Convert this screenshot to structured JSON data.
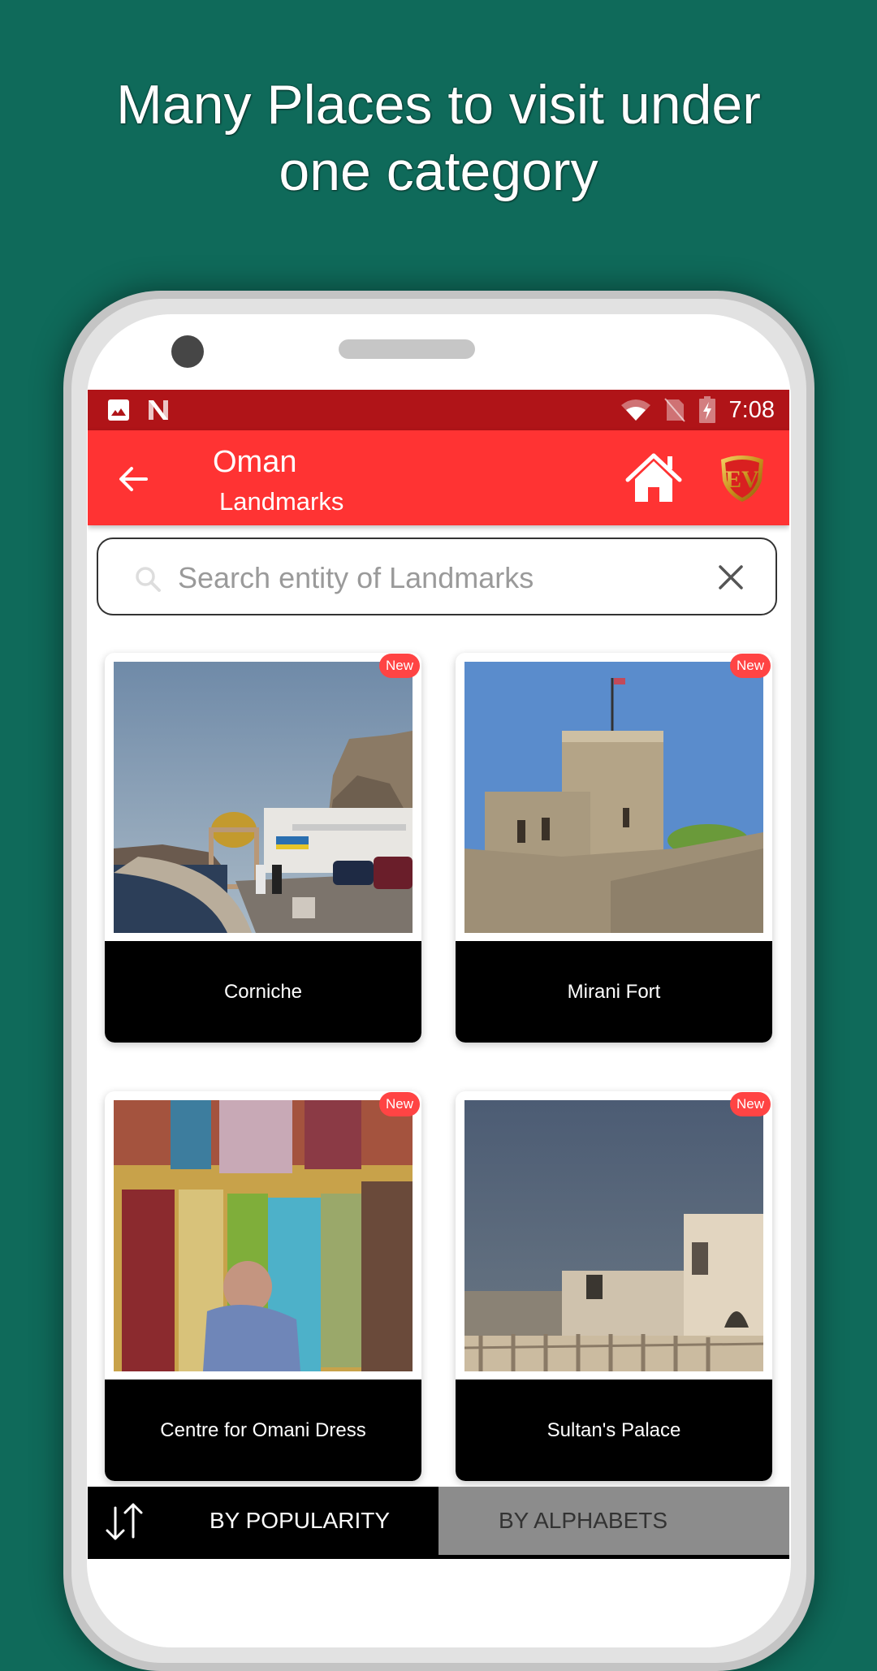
{
  "promo": {
    "headline_line1": "Many Places to visit under",
    "headline_line2": "one category"
  },
  "colors": {
    "background": "#0f6a5a",
    "status_bar": "#b01418",
    "app_bar": "#ff3333",
    "badge": "#ff4444",
    "tab_inactive": "#8c8c8c"
  },
  "status_bar": {
    "left_icons": [
      "image-icon",
      "n-notification-icon"
    ],
    "right_icons": [
      "wifi-icon",
      "no-sim-icon",
      "battery-charging-icon"
    ],
    "time": "7:08"
  },
  "app_bar": {
    "back_icon": "arrow-left-icon",
    "title": "Oman",
    "subtitle": "Landmarks",
    "home_icon": "home-icon",
    "logo_text": "EV"
  },
  "search": {
    "value": "",
    "placeholder": "Search entity of Landmarks",
    "search_icon": "search-icon",
    "clear_icon": "close-icon"
  },
  "cards": [
    {
      "name": "Corniche",
      "badge": "New"
    },
    {
      "name": "Mirani Fort",
      "badge": "New"
    },
    {
      "name": "Centre for Omani Dress",
      "badge": "New"
    },
    {
      "name": "Sultan's Palace",
      "badge": "New"
    }
  ],
  "bottom_bar": {
    "sort_icon": "sort-arrows-icon",
    "tabs": [
      {
        "label": "BY POPULARITY",
        "active": true
      },
      {
        "label": "BY ALPHABETS",
        "active": false
      }
    ]
  }
}
